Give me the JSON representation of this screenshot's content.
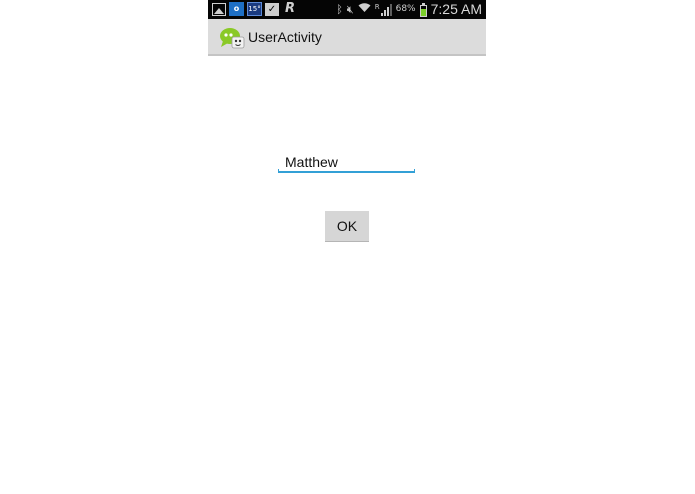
{
  "status_bar": {
    "weather_temp": "15°",
    "outlook_letter": "o",
    "battery_percent": "68%",
    "battery_level": 0.68,
    "network_label": "R",
    "time": "7:25 AM"
  },
  "action_bar": {
    "title": "UserActivity"
  },
  "form": {
    "name_value": "Matthew",
    "ok_label": "OK"
  },
  "colors": {
    "status_bar_bg": "#050505",
    "action_bar_bg": "#dcdcdc",
    "input_accent": "#33a0d6",
    "button_bg": "#d6d6d6",
    "battery_fill": "#7ccf2a"
  }
}
